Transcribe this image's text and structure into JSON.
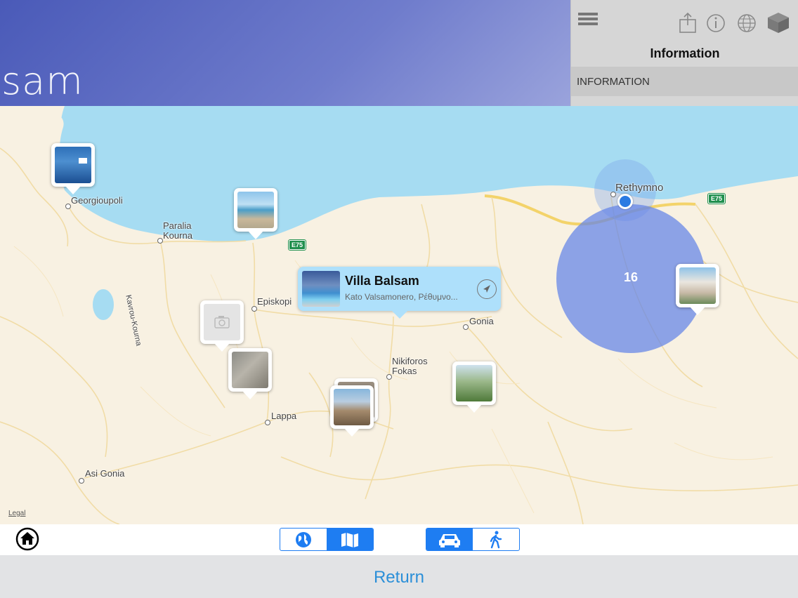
{
  "header": {
    "brand_text": "sam"
  },
  "info_panel": {
    "title": "Information",
    "row_label": "INFORMATION",
    "toolbar_icons": [
      "menu-icon",
      "share-icon",
      "info-icon",
      "globe-icon",
      "cube-icon"
    ]
  },
  "map": {
    "places": {
      "georgioupoli": "Georgioupoli",
      "paralia_kourna_1": "Paralia",
      "paralia_kourna_2": "Kourna",
      "kavrou_kourna": "Kavrou-Kourna",
      "episkopi": "Episkopi",
      "gonia": "Gonia",
      "nikiforos_1": "Nikiforos",
      "nikiforos_2": "Fokas",
      "lappa": "Lappa",
      "asi_gonia": "Asi Gonia",
      "rethymno": "Rethymno"
    },
    "road_badges": [
      "E75",
      "E75"
    ],
    "callout": {
      "title": "Villa Balsam",
      "subtitle": "Kato Valsamonero, Ρέθυμνο..."
    },
    "cluster_count": "16",
    "legal": "Legal"
  },
  "toolbar": {
    "map_mode": {
      "options": [
        "globe-icon",
        "map-icon"
      ],
      "selected": "map"
    },
    "travel_mode": {
      "options": [
        "car-icon",
        "walk-icon"
      ],
      "selected": "car"
    }
  },
  "bottom_bar": {
    "return_label": "Return"
  },
  "colors": {
    "accent": "#1e7df2",
    "sea": "#a6dcf2",
    "land": "#f8f1e2",
    "cluster": "#6284e8"
  }
}
